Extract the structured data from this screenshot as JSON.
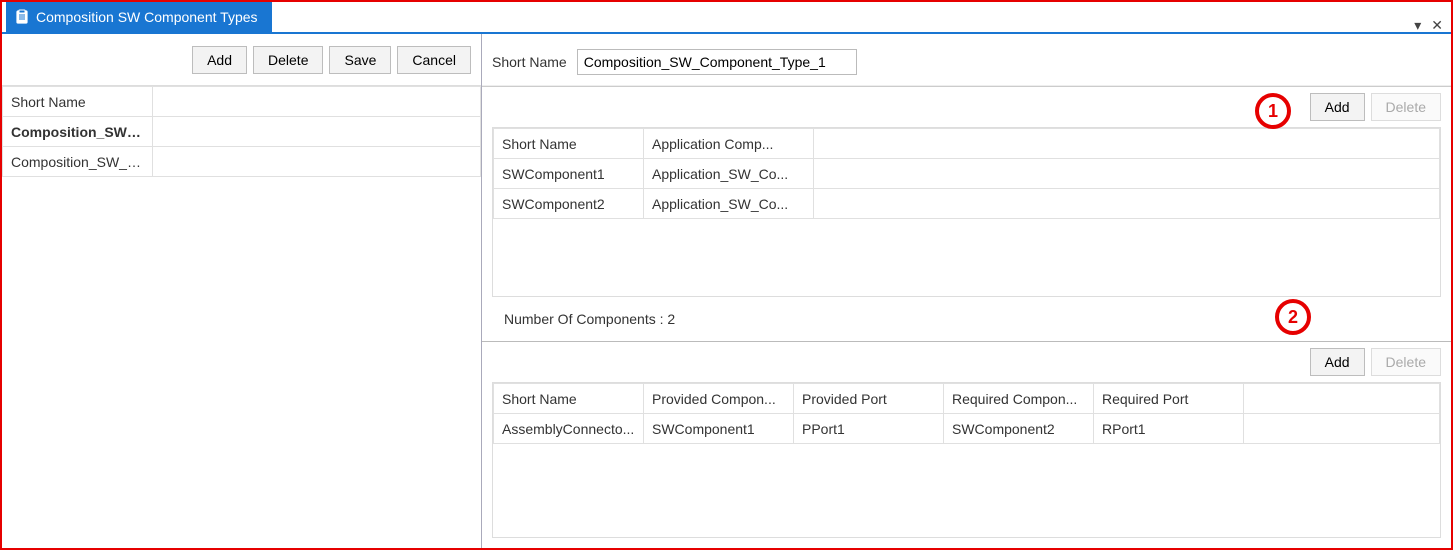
{
  "tab": {
    "title": "Composition SW Component Types"
  },
  "window_controls": {
    "minimize": "▾",
    "close": "✕"
  },
  "left": {
    "buttons": {
      "add": "Add",
      "delete": "Delete",
      "save": "Save",
      "cancel": "Cancel"
    },
    "headers": {
      "name": "Short Name",
      "blank": ""
    },
    "rows": [
      {
        "name": "Composition_SW_...",
        "blank": ""
      },
      {
        "name": "Composition_SW_C...",
        "blank": ""
      }
    ]
  },
  "right": {
    "shortname_label": "Short Name",
    "shortname_value": "Composition_SW_Component_Type_1"
  },
  "components": {
    "buttons": {
      "add": "Add",
      "delete": "Delete"
    },
    "headers": {
      "name": "Short Name",
      "type": "Application Comp..."
    },
    "rows": [
      {
        "name": "SWComponent1",
        "type": "Application_SW_Co..."
      },
      {
        "name": "SWComponent2",
        "type": "Application_SW_Co..."
      }
    ],
    "count_text": "Number Of Components : 2"
  },
  "connectors": {
    "buttons": {
      "add": "Add",
      "delete": "Delete"
    },
    "headers": {
      "name": "Short Name",
      "pcomp": "Provided Compon...",
      "pport": "Provided Port",
      "rcomp": "Required Compon...",
      "rport": "Required Port"
    },
    "rows": [
      {
        "name": "AssemblyConnecto...",
        "pcomp": "SWComponent1",
        "pport": "PPort1",
        "rcomp": "SWComponent2",
        "rport": "RPort1"
      }
    ]
  },
  "annotations": {
    "one": "1",
    "two": "2"
  }
}
